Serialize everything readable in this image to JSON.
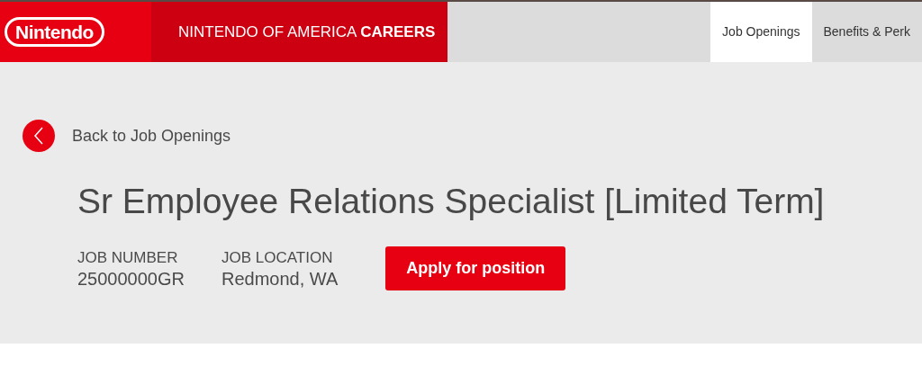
{
  "header": {
    "logo": "Nintendo",
    "site_title": {
      "prefix": "NINTENDO OF AMERICA",
      "emphasis": "CAREERS"
    },
    "nav": [
      {
        "label": "Job Openings",
        "selected": true
      },
      {
        "label": "Benefits & Perk",
        "selected": false
      }
    ]
  },
  "back_link": "Back to Job Openings",
  "job": {
    "title": "Sr Employee Relations Specialist [Limited Term]",
    "fields": [
      {
        "label": "JOB NUMBER",
        "value": "25000000GR"
      },
      {
        "label": "JOB LOCATION",
        "value": "Redmond, WA"
      }
    ],
    "apply_button": "Apply for position"
  }
}
